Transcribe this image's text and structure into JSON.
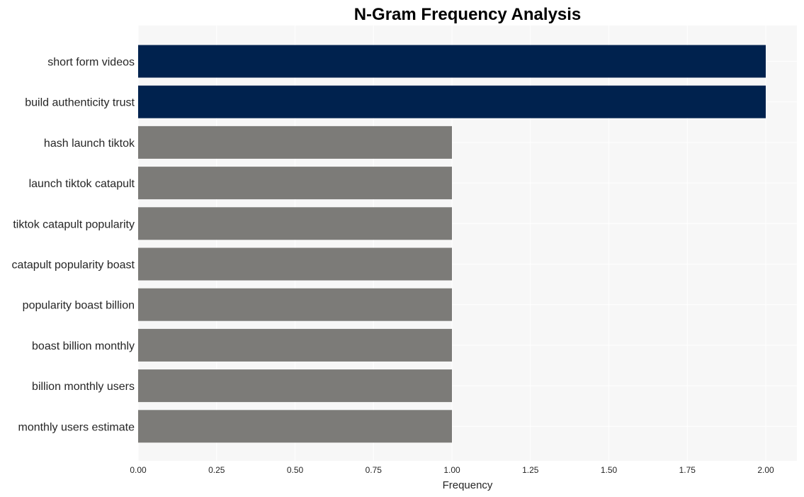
{
  "chart_data": {
    "type": "bar",
    "orientation": "horizontal",
    "title": "N-Gram Frequency Analysis",
    "xlabel": "Frequency",
    "ylabel": "",
    "xlim": [
      0,
      2.1
    ],
    "xticks": [
      "0.00",
      "0.25",
      "0.50",
      "0.75",
      "1.00",
      "1.25",
      "1.50",
      "1.75",
      "2.00"
    ],
    "grid": true,
    "categories": [
      "short form videos",
      "build authenticity trust",
      "hash launch tiktok",
      "launch tiktok catapult",
      "tiktok catapult popularity",
      "catapult popularity boast",
      "popularity boast billion",
      "boast billion monthly",
      "billion monthly users",
      "monthly users estimate"
    ],
    "values": [
      2,
      2,
      1,
      1,
      1,
      1,
      1,
      1,
      1,
      1
    ],
    "colors": {
      "highlight": "#00224e",
      "default": "#7c7b78",
      "plot_background": "#f7f7f7",
      "grid": "#ffffff"
    }
  }
}
